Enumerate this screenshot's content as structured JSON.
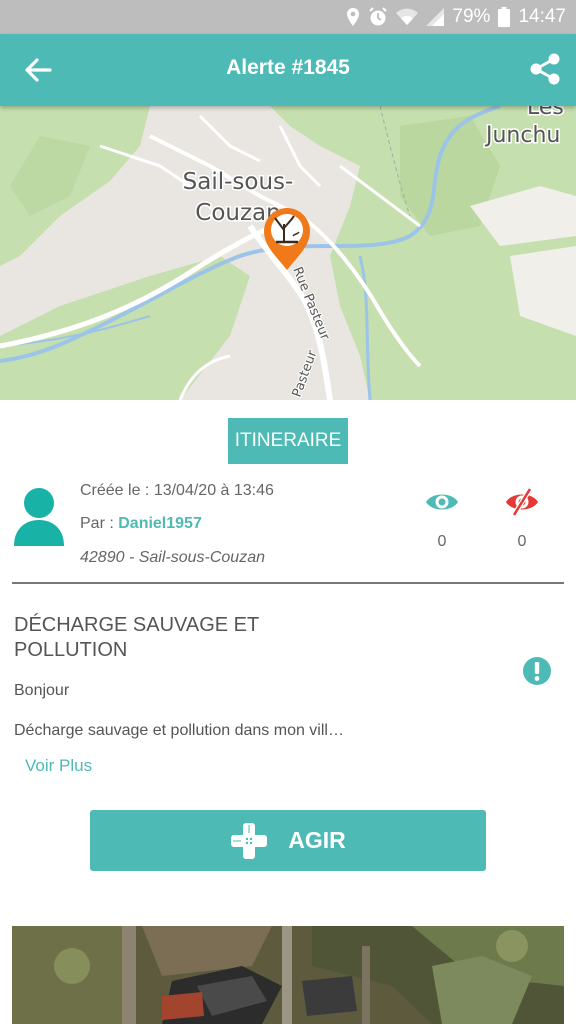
{
  "status_bar": {
    "battery": "79%",
    "time": "14:47",
    "icons": [
      "location-pin-icon",
      "alarm-icon",
      "wifi-icon",
      "signal-icon",
      "battery-icon"
    ]
  },
  "header": {
    "title": "Alerte #1845",
    "back_icon": "arrow-left-icon",
    "share_icon": "share-icon"
  },
  "map": {
    "labels": {
      "town_line1": "Sail-sous-",
      "town_line2": "Couzan",
      "place": "Junchu",
      "place_partial": "Les",
      "street": "Rue Pasteur",
      "street_partial": "Pasteur"
    },
    "marker_icon": "dead-tree-pollution-icon"
  },
  "actions": {
    "itinerary_label": "ITINERAIRE",
    "act_label": "AGIR",
    "act_icon": "bandage-cross-icon"
  },
  "alert": {
    "created": "Créée le : 13/04/20 à 13:46",
    "by_label": "Par : ",
    "author": "Daniel1957",
    "location": "42890 - Sail-sous-Couzan",
    "views_count": "0",
    "hidden_count": "0",
    "title": "DÉCHARGE SAUVAGE  ET POLLUTION",
    "greeting": "Bonjour",
    "description": "Décharge sauvage  et pollution dans mon vill…",
    "read_more": "Voir Plus"
  },
  "colors": {
    "accent": "#4dbab5",
    "danger": "#e53935",
    "marker": "#f07a1a"
  }
}
